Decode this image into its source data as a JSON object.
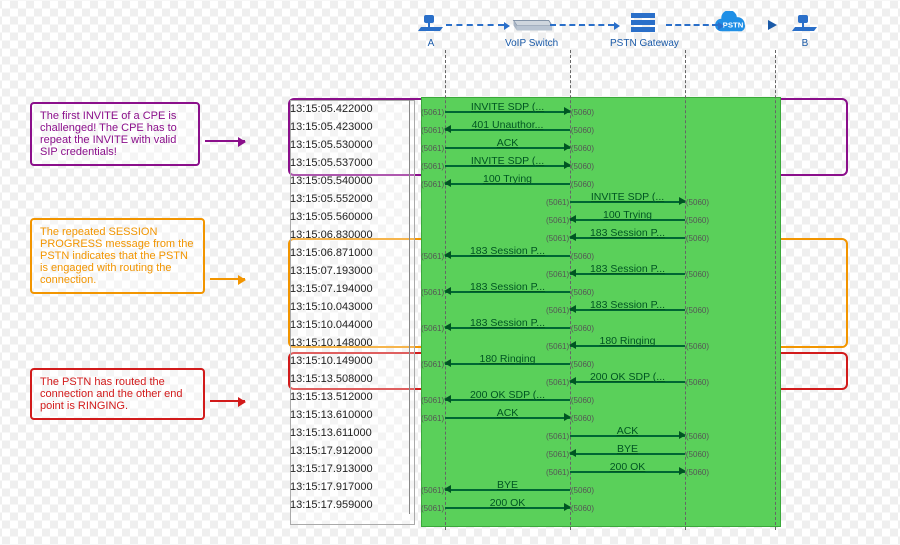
{
  "devices": {
    "a_label": "A",
    "switch_label": "VoIP Switch",
    "gateway_label": "PSTN Gateway",
    "pstn_cloud": "PSTN",
    "b_label": "B"
  },
  "annotations": {
    "purple": "The first INVITE of a CPE is challenged! The CPE has to repeat the INVITE with valid SIP credentials!",
    "orange": "The repeated SESSION PROGRESS message from the PSTN indicates that the PSTN is engaged with routing the connection.",
    "red": "The PSTN has routed the connection and the other end point is RINGING."
  },
  "ports": {
    "left": "(5061)",
    "right": "(5060)"
  },
  "lanes": {
    "A_to_Switch": "1-2",
    "Switch_to_GW": "2-3"
  },
  "rows": [
    {
      "ts": "13:15:05.422000",
      "lane": "1-2",
      "dir": "R",
      "msg": "INVITE SDP (..."
    },
    {
      "ts": "13:15:05.423000",
      "lane": "1-2",
      "dir": "L",
      "msg": "401 Unauthor..."
    },
    {
      "ts": "13:15:05.530000",
      "lane": "1-2",
      "dir": "R",
      "msg": "ACK"
    },
    {
      "ts": "13:15:05.537000",
      "lane": "1-2",
      "dir": "R",
      "msg": "INVITE SDP (..."
    },
    {
      "ts": "13:15:05.540000",
      "lane": "1-2",
      "dir": "L",
      "msg": "100 Trying"
    },
    {
      "ts": "13:15:05.552000",
      "lane": "2-3",
      "dir": "R",
      "msg": "INVITE SDP (..."
    },
    {
      "ts": "13:15:05.560000",
      "lane": "2-3",
      "dir": "L",
      "msg": "100 Trying"
    },
    {
      "ts": "13:15:06.830000",
      "lane": "2-3",
      "dir": "L",
      "msg": "183 Session P..."
    },
    {
      "ts": "13:15:06.871000",
      "lane": "1-2",
      "dir": "L",
      "msg": "183 Session P..."
    },
    {
      "ts": "13:15:07.193000",
      "lane": "2-3",
      "dir": "L",
      "msg": "183 Session P..."
    },
    {
      "ts": "13:15:07.194000",
      "lane": "1-2",
      "dir": "L",
      "msg": "183 Session P..."
    },
    {
      "ts": "13:15:10.043000",
      "lane": "2-3",
      "dir": "L",
      "msg": "183 Session P..."
    },
    {
      "ts": "13:15:10.044000",
      "lane": "1-2",
      "dir": "L",
      "msg": "183 Session P..."
    },
    {
      "ts": "13:15:10.148000",
      "lane": "2-3",
      "dir": "L",
      "msg": "180 Ringing"
    },
    {
      "ts": "13:15:10.149000",
      "lane": "1-2",
      "dir": "L",
      "msg": "180 Ringing"
    },
    {
      "ts": "13:15:13.508000",
      "lane": "2-3",
      "dir": "L",
      "msg": "200 OK SDP (..."
    },
    {
      "ts": "13:15:13.512000",
      "lane": "1-2",
      "dir": "L",
      "msg": "200 OK SDP (..."
    },
    {
      "ts": "13:15:13.610000",
      "lane": "1-2",
      "dir": "R",
      "msg": "ACK"
    },
    {
      "ts": "13:15:13.611000",
      "lane": "2-3",
      "dir": "R",
      "msg": "ACK"
    },
    {
      "ts": "13:15:17.912000",
      "lane": "2-3",
      "dir": "L",
      "msg": "BYE"
    },
    {
      "ts": "13:15:17.913000",
      "lane": "2-3",
      "dir": "R",
      "msg": "200 OK"
    },
    {
      "ts": "13:15:17.917000",
      "lane": "1-2",
      "dir": "L",
      "msg": "BYE"
    },
    {
      "ts": "13:15:17.959000",
      "lane": "1-2",
      "dir": "R",
      "msg": "200 OK"
    }
  ]
}
